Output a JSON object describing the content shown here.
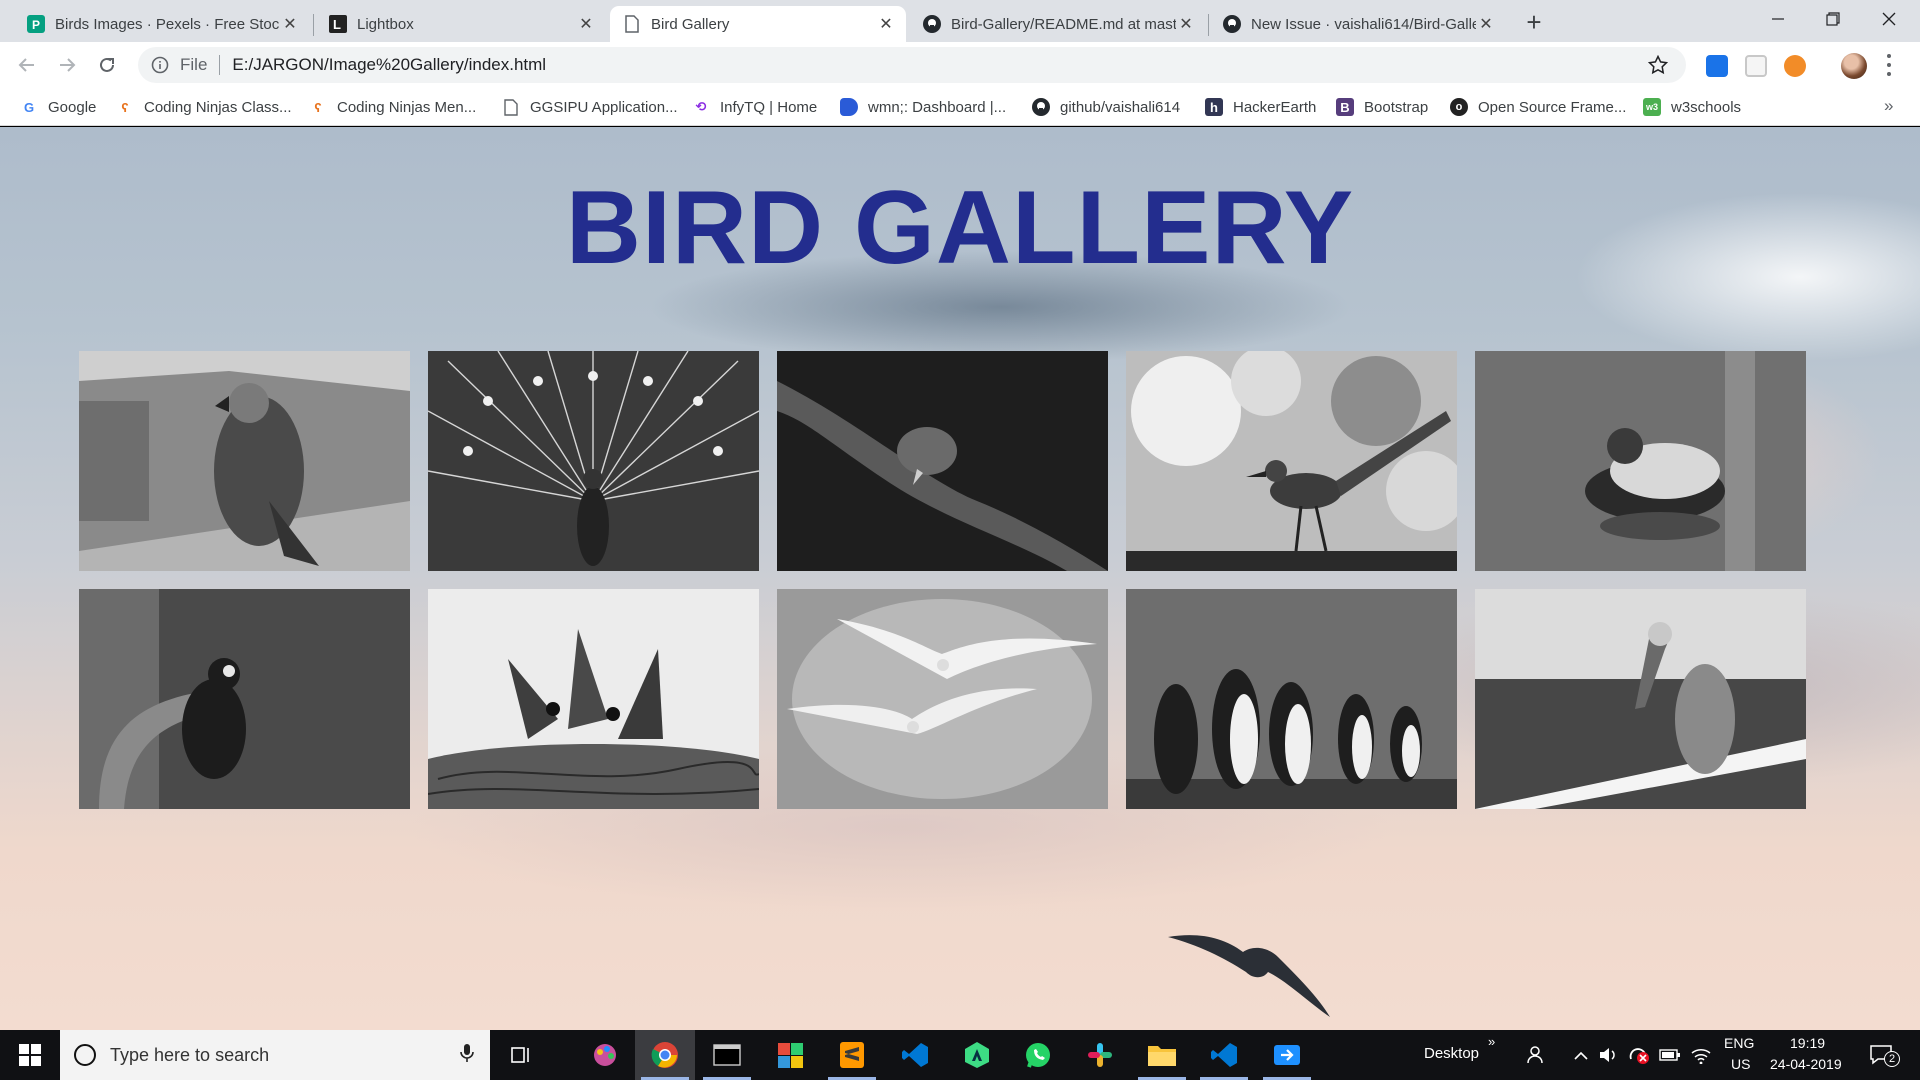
{
  "browser": {
    "tabs": [
      {
        "title": "Birds Images · Pexels · Free Stock",
        "active": false
      },
      {
        "title": "Lightbox",
        "active": false
      },
      {
        "title": "Bird Gallery",
        "active": true
      },
      {
        "title": "Bird-Gallery/README.md at mast",
        "active": false
      },
      {
        "title": "New Issue · vaishali614/Bird-Galle",
        "active": false
      }
    ],
    "address": {
      "scheme_label": "File",
      "url": "E:/JARGON/Image%20Gallery/index.html"
    },
    "bookmarks": [
      {
        "label": "Google",
        "icon": "google-icon"
      },
      {
        "label": "Coding Ninjas Class...",
        "icon": "coding-ninjas-icon"
      },
      {
        "label": "Coding Ninjas Men...",
        "icon": "coding-ninjas-icon"
      },
      {
        "label": "GGSIPU Application...",
        "icon": "page-icon"
      },
      {
        "label": "InfyTQ | Home",
        "icon": "infytq-icon"
      },
      {
        "label": "wmn;: Dashboard |...",
        "icon": "dashboard-icon"
      },
      {
        "label": "github/vaishali614",
        "icon": "github-icon"
      },
      {
        "label": "HackerEarth",
        "icon": "hackerearth-icon"
      },
      {
        "label": "Bootstrap",
        "icon": "bootstrap-icon"
      },
      {
        "label": "Open Source Frame...",
        "icon": "opensource-icon"
      },
      {
        "label": "w3schools",
        "icon": "w3schools-icon"
      }
    ]
  },
  "page": {
    "title": "BIRD GALLERY",
    "gallery": [
      {
        "subject": "macaw"
      },
      {
        "subject": "peacock"
      },
      {
        "subject": "perched-bird"
      },
      {
        "subject": "roadrunner"
      },
      {
        "subject": "mandarin-duck"
      },
      {
        "subject": "dark-bird"
      },
      {
        "subject": "nestlings"
      },
      {
        "subject": "seagulls"
      },
      {
        "subject": "penguins"
      },
      {
        "subject": "pelican"
      }
    ]
  },
  "taskbar": {
    "search_placeholder": "Type here to search",
    "desktop_label": "Desktop",
    "language_line1": "ENG",
    "language_line2": "US",
    "time": "19:19",
    "date": "24-04-2019",
    "notification_count": "2"
  },
  "colors": {
    "title": "#232d8e",
    "tab_strip": "#dee1e6",
    "taskbar": "#101114"
  }
}
